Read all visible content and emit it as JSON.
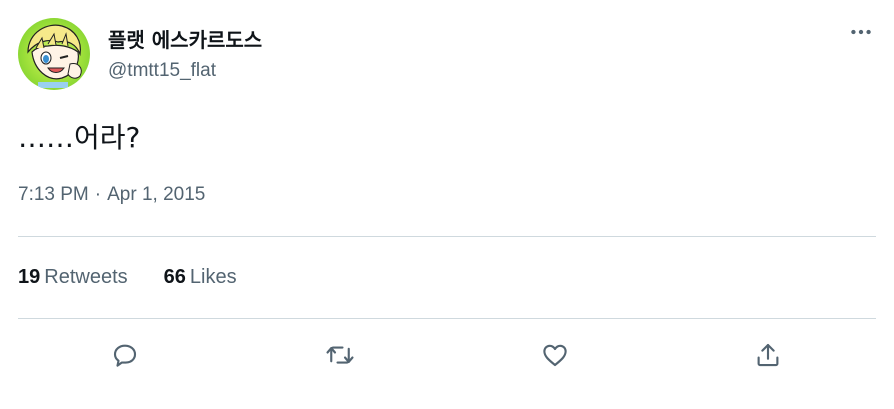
{
  "tweet": {
    "author": {
      "display_name": "플랫 에스카르도스",
      "handle": "@tmtt15_flat"
    },
    "text": "……어라?",
    "timestamp": {
      "time": "7:13 PM",
      "separator": "·",
      "date": "Apr 1, 2015"
    },
    "stats": {
      "retweets": {
        "count": "19",
        "label": "Retweets"
      },
      "likes": {
        "count": "66",
        "label": "Likes"
      }
    }
  },
  "icons": {
    "more": "more-horizontal-icon",
    "reply": "reply-icon",
    "retweet": "retweet-icon",
    "like": "heart-icon",
    "share": "share-icon"
  },
  "colors": {
    "text_primary": "#0f1419",
    "text_secondary": "#536471",
    "divider": "#cfd9de",
    "avatar_bg": "#9ee03a"
  }
}
